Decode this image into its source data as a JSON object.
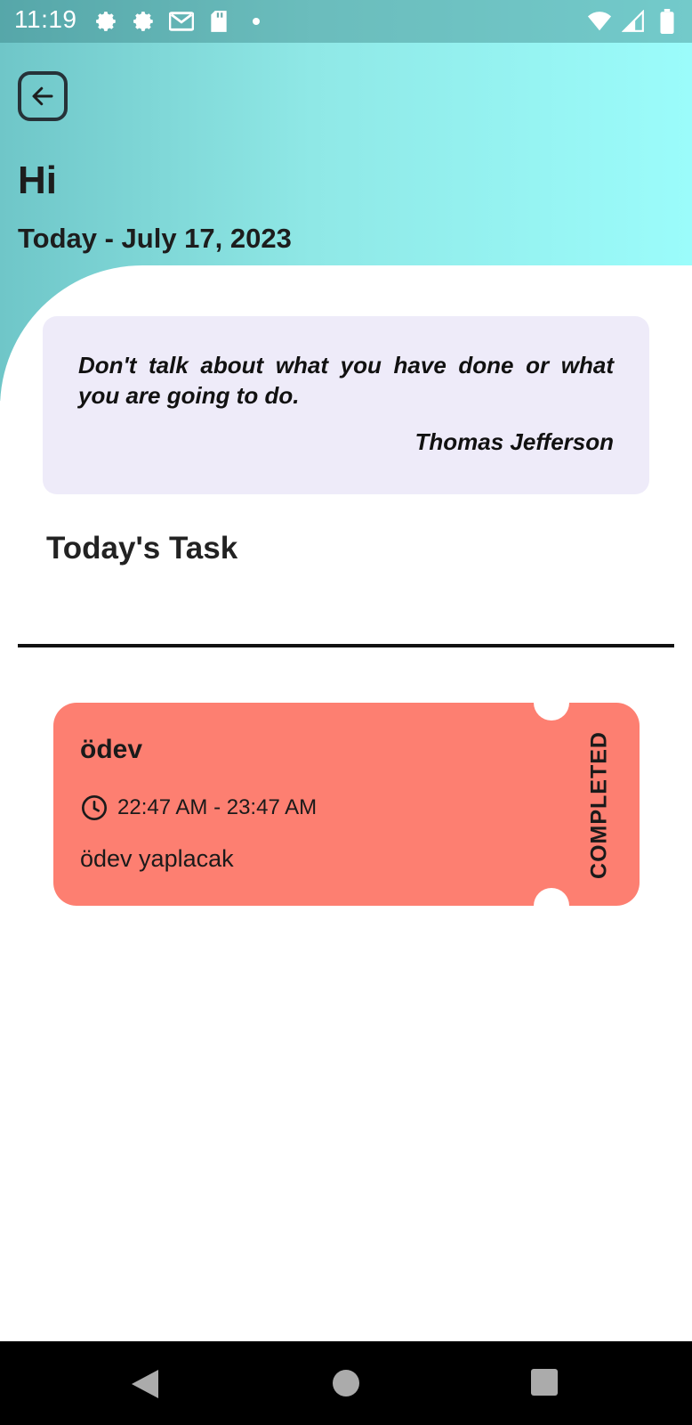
{
  "status_bar": {
    "time": "11:19",
    "left_icons": [
      "gear-icon",
      "gear-icon",
      "gmail-icon",
      "sd-card-icon",
      "dot-icon"
    ],
    "right_icons": [
      "wifi-icon",
      "signal-icon",
      "battery-icon"
    ]
  },
  "header": {
    "greeting": "Hi",
    "date_line": "Today - July 17, 2023"
  },
  "quote": {
    "text": "Don't talk about what you have done or what you are going to do.",
    "author": "Thomas Jefferson"
  },
  "section": {
    "title": "Today's Task"
  },
  "tasks": [
    {
      "title": "ödev",
      "time": "22:47 AM - 23:47 AM",
      "description": "ödev yaplacak",
      "status": "COMPLETED",
      "color": "#fd7f71"
    }
  ],
  "colors": {
    "header_gradient_start": "#6fc6c8",
    "header_gradient_end": "#9bfcfb",
    "quote_bg": "#eeebf9",
    "task_bg": "#fd7f71"
  },
  "nav": {
    "icons": [
      "back-triangle-icon",
      "home-circle-icon",
      "recents-square-icon"
    ]
  }
}
